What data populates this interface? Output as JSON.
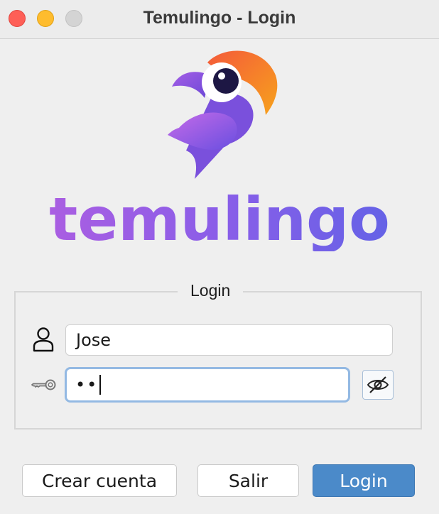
{
  "window": {
    "title": "Temulingo - Login"
  },
  "logo": {
    "wordmark": "temulingo",
    "mascot_icon": "parrot-logo-icon"
  },
  "login_group": {
    "legend": "Login",
    "username": {
      "icon": "user-icon",
      "value": "Jose"
    },
    "password": {
      "icon": "key-icon",
      "masked_value": "••",
      "toggle_icon": "eye-slash-icon"
    }
  },
  "buttons": {
    "create_account": "Crear cuenta",
    "exit": "Salir",
    "login": "Login"
  },
  "colors": {
    "primary_button": "#4b8ac9",
    "focus_ring": "#93b9e3",
    "logo_gradient_start": "#b35ee0",
    "logo_gradient_end": "#5a63e6"
  }
}
